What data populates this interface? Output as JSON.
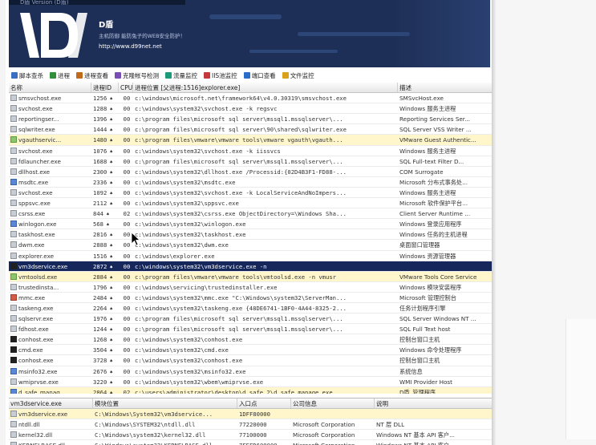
{
  "window": {
    "title_fragment": "D盾 Version (D盾)",
    "brand_name": "D盾",
    "brand_slogan": "主机防御 能防兔子的WEB安全防护！",
    "brand_url": "http://www.d99net.net"
  },
  "toolbar": {
    "items": [
      {
        "label": "脚本查杀",
        "icon": "script-scan-icon",
        "color": "#3a6fc4"
      },
      {
        "label": "进程",
        "icon": "process-icon",
        "color": "#2f8f3a"
      },
      {
        "label": "进程查看",
        "icon": "process-view-icon",
        "color": "#c06a1b"
      },
      {
        "label": "克隆帐号检测",
        "icon": "clone-account-icon",
        "color": "#7a4fb5"
      },
      {
        "label": "流量监控",
        "icon": "traffic-monitor-icon",
        "color": "#1d9a7a"
      },
      {
        "label": "IIS池监控",
        "icon": "iis-pool-icon",
        "color": "#c43a3a"
      },
      {
        "label": "端口查看",
        "icon": "port-view-icon",
        "color": "#2a6ec9"
      },
      {
        "label": "文件监控",
        "icon": "file-monitor-icon",
        "color": "#d9a21a"
      }
    ]
  },
  "process_table": {
    "headers": {
      "name": "名称",
      "pid": "进程ID",
      "cpu": "CPU",
      "path": "进程位置 [父进程:1516]explorer.exe]",
      "desc": "描述"
    },
    "rows": [
      {
        "name": "smsvchost.exe",
        "pid": "1256",
        "cpu": "00",
        "path": "c:\\windows\\microsoft.net\\framework64\\v4.0.30319\\smsvchost.exe",
        "desc": "SMSvcHost.exe",
        "icon": "gray",
        "style": ""
      },
      {
        "name": "svchost.exe",
        "pid": "1288",
        "cpu": "00",
        "path": "c:\\windows\\system32\\svchost.exe -k regsvc",
        "desc": "Windows 服务主进程",
        "icon": "gray",
        "style": ""
      },
      {
        "name": "reportingser...",
        "pid": "1396",
        "cpu": "00",
        "path": "c:\\program files\\microsoft sql server\\mssql1.mssqlserver\\...",
        "desc": "Reporting Services Ser...",
        "icon": "gray",
        "style": ""
      },
      {
        "name": "sqlwriter.exe",
        "pid": "1444",
        "cpu": "00",
        "path": "c:\\program files\\microsoft sql server\\90\\shared\\sqlwriter.exe",
        "desc": "SQL Server VSS Writer ...",
        "icon": "gray",
        "style": ""
      },
      {
        "name": "vgauthservic...",
        "pid": "1480",
        "cpu": "00",
        "path": "c:\\program files\\vmware\\vmware tools\\vmware vgauth\\vgauth...",
        "desc": "VMware Guest Authentic...",
        "icon": "green",
        "style": "yellow"
      },
      {
        "name": "svchost.exe",
        "pid": "1076",
        "cpu": "00",
        "path": "c:\\windows\\system32\\svchost.exe -k iissvcs",
        "desc": "Windows 服务主进程",
        "icon": "gray",
        "style": ""
      },
      {
        "name": "fdlauncher.exe",
        "pid": "1688",
        "cpu": "00",
        "path": "c:\\program files\\microsoft sql server\\mssql1.mssqlserver\\...",
        "desc": "SQL Full-text Filter D...",
        "icon": "gray",
        "style": ""
      },
      {
        "name": "dllhost.exe",
        "pid": "2300",
        "cpu": "00",
        "path": "c:\\windows\\system32\\dllhost.exe /Processid:{02D4B3F1-FD88-...",
        "desc": "COM Surrogate",
        "icon": "gray",
        "style": ""
      },
      {
        "name": "msdtc.exe",
        "pid": "2336",
        "cpu": "00",
        "path": "c:\\windows\\system32\\msdtc.exe",
        "desc": "Microsoft 分布式事务处...",
        "icon": "blue",
        "style": ""
      },
      {
        "name": "svchost.exe",
        "pid": "1092",
        "cpu": "00",
        "path": "c:\\windows\\system32\\svchost.exe -k LocalServiceAndNoImpers...",
        "desc": "Windows 服务主进程",
        "icon": "gray",
        "style": ""
      },
      {
        "name": "sppsvc.exe",
        "pid": "2112",
        "cpu": "00",
        "path": "c:\\windows\\system32\\sppsvc.exe",
        "desc": "Microsoft 软件保护平台...",
        "icon": "gray",
        "style": ""
      },
      {
        "name": "csrss.exe",
        "pid": "844",
        "cpu": "02",
        "path": "c:\\windows\\system32\\csrss.exe ObjectDirectory=\\Windows Sha...",
        "desc": "Client Server Runtime ...",
        "icon": "gray",
        "style": ""
      },
      {
        "name": "winlogon.exe",
        "pid": "568",
        "cpu": "00",
        "path": "c:\\windows\\system32\\winlogon.exe",
        "desc": "Windows 登录应用程序",
        "icon": "blue",
        "style": ""
      },
      {
        "name": "taskhost.exe",
        "pid": "2816",
        "cpu": "00",
        "path": "c:\\windows\\system32\\taskhost.exe",
        "desc": "Windows 任务的主机进程",
        "icon": "gray",
        "style": ""
      },
      {
        "name": "dwm.exe",
        "pid": "2888",
        "cpu": "00",
        "path": "c:\\windows\\system32\\dwm.exe",
        "desc": "桌面窗口管理器",
        "icon": "gray",
        "style": ""
      },
      {
        "name": "explorer.exe",
        "pid": "1516",
        "cpu": "00",
        "path": "c:\\windows\\explorer.exe",
        "desc": "Windows 资源管理器",
        "icon": "gray",
        "style": ""
      },
      {
        "name": "vm3dservice.exe",
        "pid": "2872",
        "cpu": "00",
        "path": "c:\\windows\\system32\\vm3dservice.exe -n",
        "desc": "",
        "icon": "dark",
        "style": "selected"
      },
      {
        "name": "vmtoolsd.exe",
        "pid": "2884",
        "cpu": "00",
        "path": "c:\\program files\\vmware\\vmware tools\\vmtoolsd.exe -n vmusr",
        "desc": "VMware Tools Core Service",
        "icon": "green",
        "style": "yellow"
      },
      {
        "name": "trustedinsta...",
        "pid": "1796",
        "cpu": "00",
        "path": "c:\\windows\\servicing\\trustedinstaller.exe",
        "desc": "Windows 模块安装程序",
        "icon": "gray",
        "style": ""
      },
      {
        "name": "mmc.exe",
        "pid": "2484",
        "cpu": "00",
        "path": "c:\\windows\\system32\\mmc.exe \"C:\\Windows\\system32\\ServerMan...",
        "desc": "Microsoft 管理控制台",
        "icon": "red",
        "style": ""
      },
      {
        "name": "taskeng.exe",
        "pid": "2264",
        "cpu": "00",
        "path": "c:\\windows\\system32\\taskeng.exe {48DE6741-1BF0-4A44-8325-2...",
        "desc": "任务计划程序引擎",
        "icon": "gray",
        "style": ""
      },
      {
        "name": "sqlservr.exe",
        "pid": "1976",
        "cpu": "00",
        "path": "c:\\program files\\microsoft sql server\\mssql1.mssqlserver\\...",
        "desc": "SQL Server Windows NT ...",
        "icon": "gray",
        "style": ""
      },
      {
        "name": "fdhost.exe",
        "pid": "1244",
        "cpu": "00",
        "path": "c:\\program files\\microsoft sql server\\mssql1.mssqlserver\\...",
        "desc": "SQL Full Text host",
        "icon": "gray",
        "style": ""
      },
      {
        "name": "conhost.exe",
        "pid": "1268",
        "cpu": "00",
        "path": "c:\\windows\\system32\\conhost.exe",
        "desc": "控制台窗口主机",
        "icon": "dark",
        "style": ""
      },
      {
        "name": "cmd.exe",
        "pid": "3504",
        "cpu": "00",
        "path": "c:\\windows\\system32\\cmd.exe",
        "desc": "Windows 命令处理程序",
        "icon": "dark",
        "style": ""
      },
      {
        "name": "conhost.exe",
        "pid": "3728",
        "cpu": "00",
        "path": "c:\\windows\\system32\\conhost.exe",
        "desc": "控制台窗口主机",
        "icon": "dark",
        "style": ""
      },
      {
        "name": "msinfo32.exe",
        "pid": "2676",
        "cpu": "00",
        "path": "c:\\windows\\system32\\msinfo32.exe",
        "desc": "系统信息",
        "icon": "blue",
        "style": ""
      },
      {
        "name": "wmiprvse.exe",
        "pid": "3220",
        "cpu": "00",
        "path": "c:\\windows\\system32\\wbem\\wmiprvse.exe",
        "desc": "WMI Provider Host",
        "icon": "gray",
        "style": ""
      },
      {
        "name": "d_safe_manag...",
        "pid": "2864",
        "cpu": "02",
        "path": "c:\\users\\administrator\\desktop\\d_safe_2\\d_safe_manage.exe",
        "desc": "D盾_管理程序",
        "icon": "blue",
        "style": "yellow"
      }
    ]
  },
  "module_table": {
    "headers": {
      "name": "vm3dservice.exe",
      "path": "模块位置",
      "entry": "入口点",
      "corp": "公司信息",
      "desc": "说明"
    },
    "rows": [
      {
        "name": "vm3dservice.exe",
        "path": "C:\\Windows\\System32\\vm3dservice...",
        "entry": "1DFF80000",
        "corp": "",
        "desc": "",
        "style": "yellow"
      },
      {
        "name": "ntdll.dll",
        "path": "C:\\Windows\\SYSTEM32\\ntdll.dll",
        "entry": "77220000",
        "corp": "Microsoft Corporation",
        "desc": "NT 层 DLL",
        "style": ""
      },
      {
        "name": "kernel32.dll",
        "path": "C:\\Windows\\system32\\kernel32.dll",
        "entry": "77100000",
        "corp": "Microsoft Corporation",
        "desc": "Windows NT 基本 API 客户...",
        "style": ""
      },
      {
        "name": "KERNELBASE.dll",
        "path": "C:\\Windows\\system32\\KERNELBASE.dll",
        "entry": "7FEFD600000",
        "corp": "Microsoft Corporation",
        "desc": "Windows NT 基本 API 客户...",
        "style": ""
      }
    ]
  }
}
